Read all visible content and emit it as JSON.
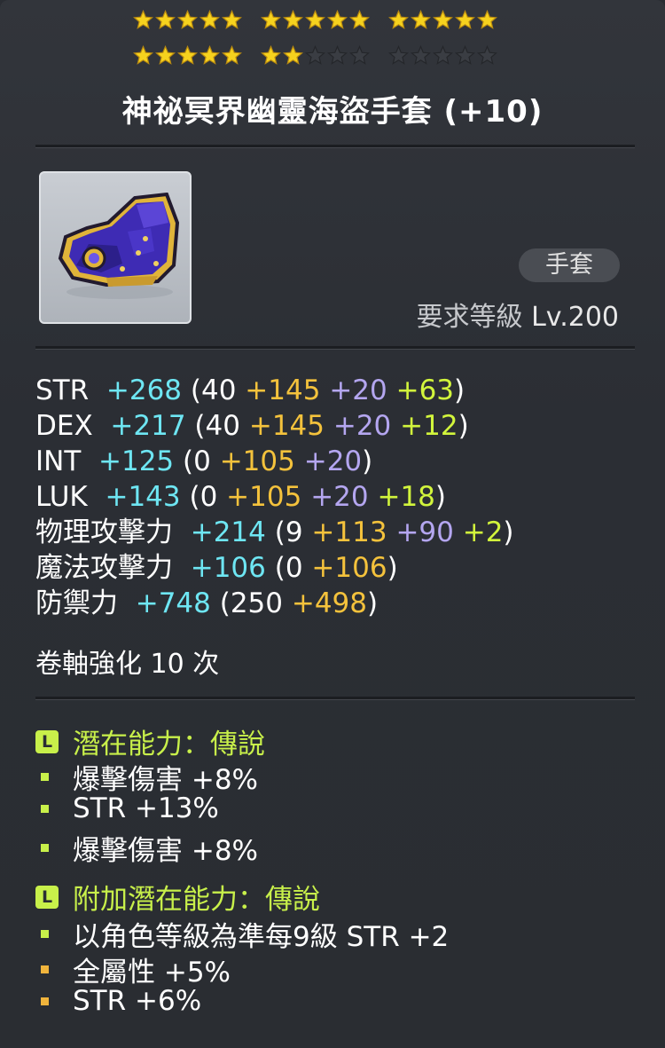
{
  "stars": {
    "filled": 22,
    "total": 30
  },
  "item": {
    "name": "神祕冥界幽靈海盜手套 (+10)",
    "category": "手套",
    "req_label": "要求等級",
    "req_level": "Lv.200"
  },
  "stats": [
    {
      "label": "STR",
      "total": "+268",
      "base": "40",
      "star": "+145",
      "scroll": "+20",
      "flame": "+63"
    },
    {
      "label": "DEX",
      "total": "+217",
      "base": "40",
      "star": "+145",
      "scroll": "+20",
      "flame": "+12"
    },
    {
      "label": "INT",
      "total": "+125",
      "base": "0",
      "star": "+105",
      "scroll": "+20"
    },
    {
      "label": "LUK",
      "total": "+143",
      "base": "0",
      "star": "+105",
      "scroll": "+20",
      "flame": "+18"
    },
    {
      "label": "物理攻擊力",
      "total": "+214",
      "base": "9",
      "star": "+113",
      "scroll": "+90",
      "flame": "+2"
    },
    {
      "label": "魔法攻擊力",
      "total": "+106",
      "base": "0",
      "star": "+106"
    },
    {
      "label": "防禦力",
      "total": "+748",
      "base": "250",
      "star": "+498"
    }
  ],
  "scroll_enhance": "卷軸強化 10 次",
  "potential": {
    "badge": "L",
    "header": "潛在能力：傳說",
    "lines": [
      "爆擊傷害 +8%",
      "STR +13%",
      "爆擊傷害 +8%"
    ]
  },
  "bonus_potential": {
    "badge": "L",
    "header": "附加潛在能力：傳說",
    "lines": [
      "以角色等級為準每9級 STR +2",
      "全屬性 +5%",
      "STR +6%"
    ]
  },
  "colors": {
    "total": "#6ee6f3",
    "star": "#f4c23c",
    "scroll": "#b4a6f0",
    "flame": "#d2f53c",
    "legendary": "#c8f04a",
    "bullet_green": "#c8f04a",
    "bullet_gold": "#f0b43c"
  }
}
